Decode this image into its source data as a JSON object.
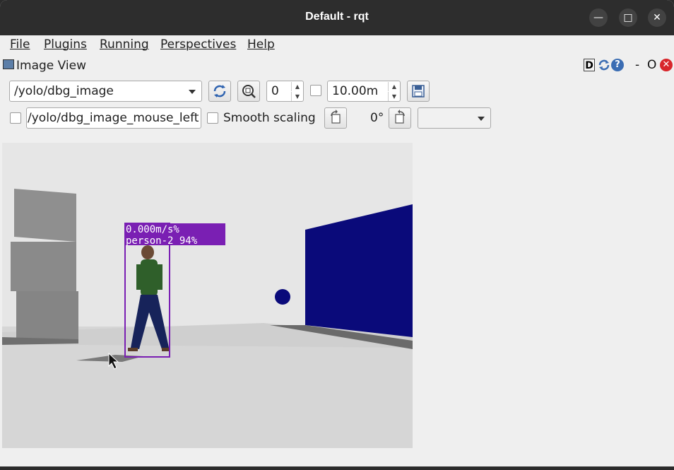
{
  "window": {
    "title": "Default - rqt",
    "minimize_glyph": "—",
    "maximize_glyph": "□",
    "close_glyph": "✕"
  },
  "menu": {
    "items": [
      {
        "label": "File"
      },
      {
        "label": "Plugins"
      },
      {
        "label": "Running"
      },
      {
        "label": "Perspectives"
      },
      {
        "label": "Help"
      }
    ]
  },
  "dock": {
    "title": "Image View",
    "d_label": "D",
    "help_glyph": "?",
    "minimize_label": "-",
    "o_label": "O",
    "close_glyph": "✕"
  },
  "toolbar": {
    "topic": "/yolo/dbg_image",
    "zoom_value": "0",
    "duration_value": "10.00m",
    "mouse_topic": "/yolo/dbg_image_mouse_left",
    "smooth_scaling_label": "Smooth scaling",
    "rotation_label": "0°",
    "rotation_select": ""
  },
  "image": {
    "detection_label_line1": "0.000m/s%",
    "detection_label_line2": "person-2 94%",
    "colors": {
      "detection_box": "#7a1fb3",
      "wall_blue": "#0a0a7a",
      "floor": "#d8d8d8",
      "sky": "#e6e6e6"
    }
  }
}
